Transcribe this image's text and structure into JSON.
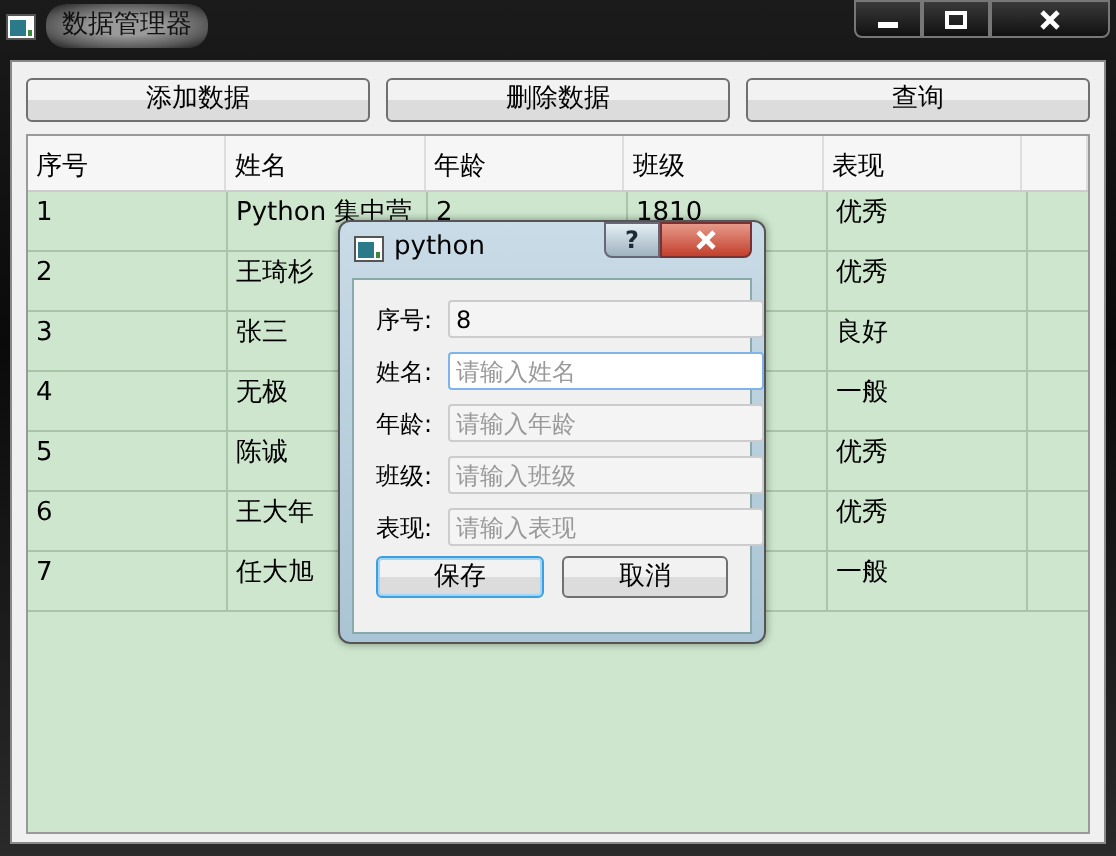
{
  "window": {
    "title": "数据管理器"
  },
  "toolbar": [
    {
      "label": "添加数据"
    },
    {
      "label": "删除数据"
    },
    {
      "label": "查询"
    }
  ],
  "table": {
    "columns": [
      "序号",
      "姓名",
      "年龄",
      "班级",
      "表现"
    ],
    "rows": [
      {
        "id": "1",
        "name": "Python 集中营",
        "age": "2",
        "class": "1810",
        "grade": "优秀"
      },
      {
        "id": "2",
        "name": "王琦杉",
        "grade": "优秀"
      },
      {
        "id": "3",
        "name": "张三",
        "grade": "良好"
      },
      {
        "id": "4",
        "name": "无极",
        "grade": "一般"
      },
      {
        "id": "5",
        "name": "陈诚",
        "grade": "优秀"
      },
      {
        "id": "6",
        "name": "王大年",
        "grade": "优秀"
      },
      {
        "id": "7",
        "name": "任大旭",
        "grade": "一般"
      }
    ]
  },
  "dialog": {
    "title": "python",
    "help": "?",
    "fields": [
      {
        "label": "序号:",
        "value": "8",
        "focused": false
      },
      {
        "label": "姓名:",
        "placeholder": "请输入姓名",
        "focused": true
      },
      {
        "label": "年龄:",
        "placeholder": "请输入年龄",
        "focused": false
      },
      {
        "label": "班级:",
        "placeholder": "请输入班级",
        "focused": false
      },
      {
        "label": "表现:",
        "placeholder": "请输入表现",
        "focused": false
      }
    ],
    "buttons": [
      {
        "label": "保存",
        "default": true
      },
      {
        "label": "取消",
        "default": false
      }
    ]
  }
}
